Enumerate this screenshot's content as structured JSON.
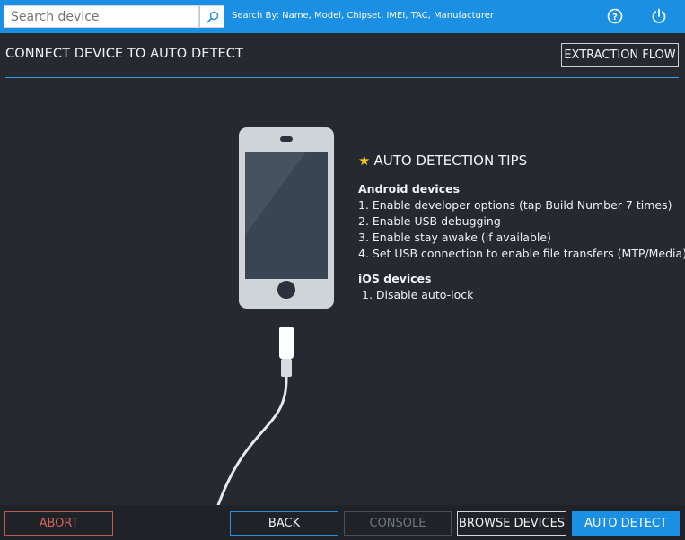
{
  "topbar": {
    "search_placeholder": "Search device",
    "search_hint": "Search By: Name, Model, Chipset, IMEI, TAC, Manufacturer",
    "help_icon": "help-circle-icon",
    "power_icon": "power-icon"
  },
  "header": {
    "title": "CONNECT DEVICE TO AUTO DETECT",
    "extraction_flow_label": "EXTRACTION FLOW"
  },
  "tips": {
    "title": "AUTO DETECTION TIPS",
    "android": {
      "heading": "Android devices",
      "items": [
        "1. Enable developer options (tap Build Number 7 times)",
        "2. Enable USB debugging",
        "3. Enable stay awake (if available)",
        "4. Set USB connection to enable file transfers (MTP/Media)"
      ]
    },
    "ios": {
      "heading": "iOS devices",
      "items": [
        "1. Disable auto-lock"
      ]
    }
  },
  "footer": {
    "abort_label": "ABORT",
    "back_label": "BACK",
    "console_label": "CONSOLE",
    "browse_label": "BROWSE DEVICES",
    "auto_detect_label": "AUTO DETECT"
  },
  "colors": {
    "accent": "#1a8fe3",
    "background": "#262a30",
    "abort": "#d9635c",
    "star": "#f5c518"
  }
}
